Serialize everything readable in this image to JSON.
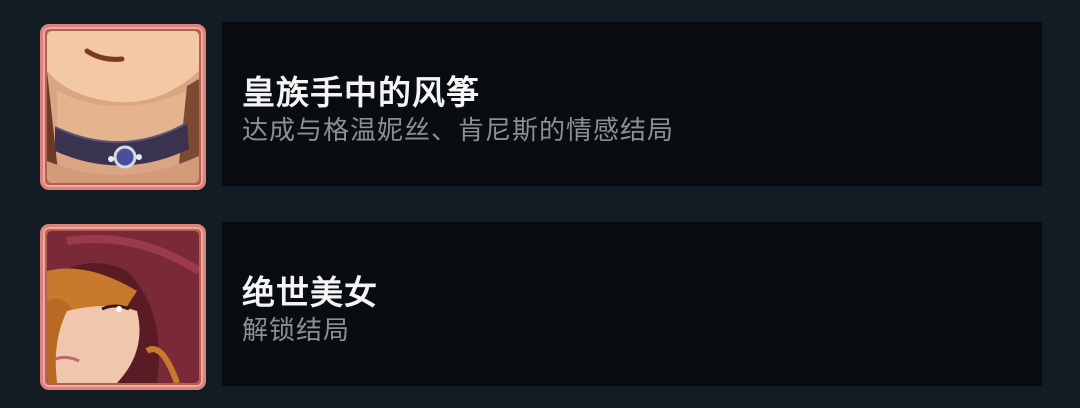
{
  "achievements": [
    {
      "title": "皇族手中的风筝",
      "description": "达成与格温妮丝、肯尼斯的情感结局",
      "icon": "portrait-choker-icon"
    },
    {
      "title": "绝世美女",
      "description": "解锁结局",
      "icon": "portrait-hooded-woman-icon"
    }
  ],
  "colors": {
    "background": "#131c25",
    "panel": "#090d12",
    "frame": "#d9837a",
    "title": "#f4f4f4",
    "subtitle": "#8c9095"
  }
}
